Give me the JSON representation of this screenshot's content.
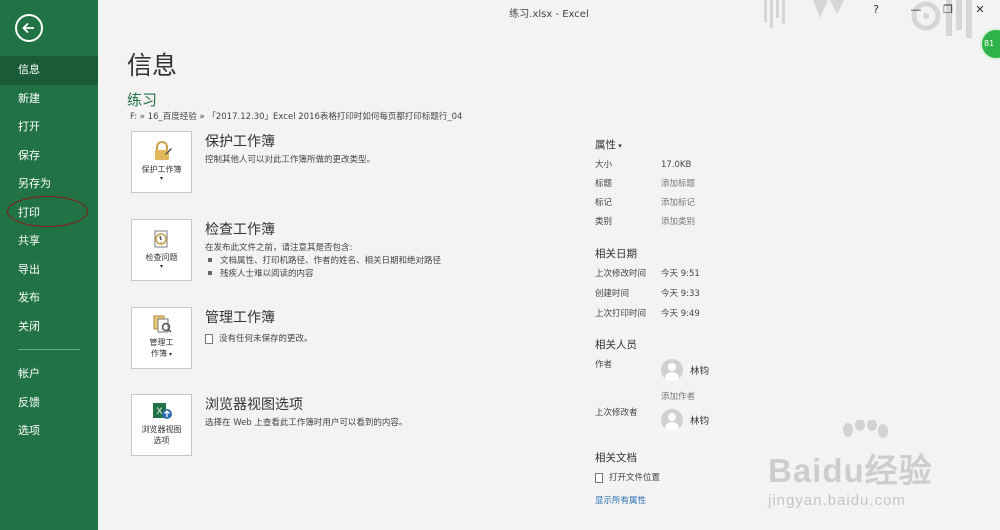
{
  "window": {
    "title": "练习.xlsx  -  Excel",
    "help": "?",
    "badge": "81"
  },
  "sidebar": {
    "items": [
      {
        "label": "信息"
      },
      {
        "label": "新建"
      },
      {
        "label": "打开"
      },
      {
        "label": "保存"
      },
      {
        "label": "另存为"
      },
      {
        "label": "打印"
      },
      {
        "label": "共享"
      },
      {
        "label": "导出"
      },
      {
        "label": "发布"
      },
      {
        "label": "关闭"
      },
      {
        "label": "帐户"
      },
      {
        "label": "反馈"
      },
      {
        "label": "选项"
      }
    ],
    "active_index": 0
  },
  "main": {
    "title": "信息",
    "doc_name": "练习",
    "doc_path": "F: » 16_百度经验 » 「2017.12.30」Excel 2016表格打印时如何每页都打印标题行_04",
    "sections": [
      {
        "button_label": "保护工作簿",
        "title": "保护工作簿",
        "desc": "控制其他人可以对此工作簿所做的更改类型。",
        "icon": "lock-icon"
      },
      {
        "button_label": "检查问题",
        "title": "检查工作簿",
        "desc": "在发布此文件之前，请注意其是否包含:",
        "bullets": [
          "文档属性、打印机路径、作者的姓名、相关日期和绝对路径",
          "残疾人士难以阅读的内容"
        ],
        "icon": "inspect-icon"
      },
      {
        "button_label_1": "管理工",
        "button_label_2": "作簿",
        "title": "管理工作簿",
        "desc": "没有任何未保存的更改。",
        "icon": "manage-icon"
      },
      {
        "button_label_1": "浏览器视图",
        "button_label_2": "选项",
        "title": "浏览器视图选项",
        "desc": "选择在 Web 上查看此工作簿时用户可以看到的内容。",
        "icon": "browser-view-icon"
      }
    ]
  },
  "properties": {
    "header": "属性",
    "rows": [
      {
        "key": "大小",
        "value": "17.0KB"
      },
      {
        "key": "标题",
        "value": "添加标题"
      },
      {
        "key": "标记",
        "value": "添加标记"
      },
      {
        "key": "类别",
        "value": "添加类别"
      }
    ],
    "dates_header": "相关日期",
    "dates": [
      {
        "key": "上次修改时间",
        "value": "今天 9:51"
      },
      {
        "key": "创建时间",
        "value": "今天 9:33"
      },
      {
        "key": "上次打印时间",
        "value": "今天 9:49"
      }
    ],
    "people_header": "相关人员",
    "author_label": "作者",
    "author_name": "林钧",
    "add_author": "添加作者",
    "modifier_label": "上次修改者",
    "modifier_name": "林钧",
    "docs_header": "相关文档",
    "open_location": "打开文件位置",
    "show_all": "显示所有属性"
  },
  "watermark": {
    "brand": "Baidu经验",
    "url": "jingyan.baidu.com"
  }
}
